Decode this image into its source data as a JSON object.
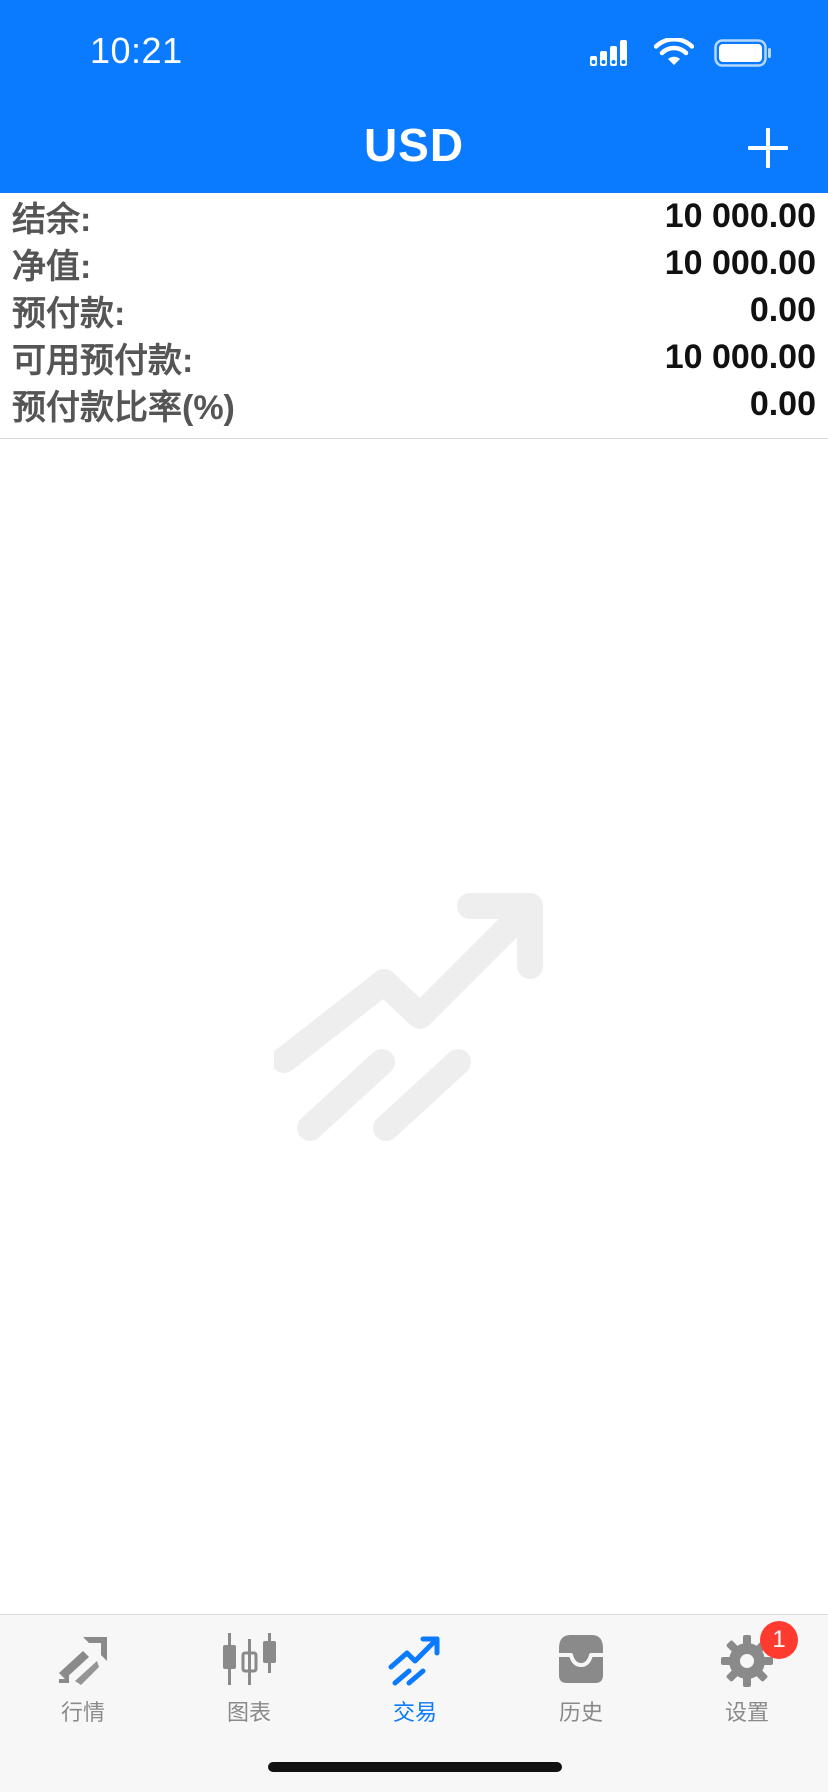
{
  "status_bar": {
    "time": "10:21"
  },
  "header": {
    "title": "USD",
    "background_color": "#0a7aff"
  },
  "summary": {
    "rows": [
      {
        "label": "结余:",
        "value": "10 000.00"
      },
      {
        "label": "净值:",
        "value": "10 000.00"
      },
      {
        "label": "预付款:",
        "value": "0.00"
      },
      {
        "label": "可用预付款:",
        "value": "10 000.00"
      },
      {
        "label": "预付款比率(%)",
        "value": "0.00"
      }
    ]
  },
  "tabs": [
    {
      "label": "行情",
      "icon": "quotes-icon",
      "active": false
    },
    {
      "label": "图表",
      "icon": "chart-candles-icon",
      "active": false
    },
    {
      "label": "交易",
      "icon": "trade-icon",
      "active": true
    },
    {
      "label": "历史",
      "icon": "history-inbox-icon",
      "active": false
    },
    {
      "label": "设置",
      "icon": "gear-icon",
      "active": false,
      "badge": "1"
    }
  ],
  "colors": {
    "accent": "#0a7aff",
    "badge": "#ff3b30",
    "tab_inactive": "#8a8a8a"
  }
}
